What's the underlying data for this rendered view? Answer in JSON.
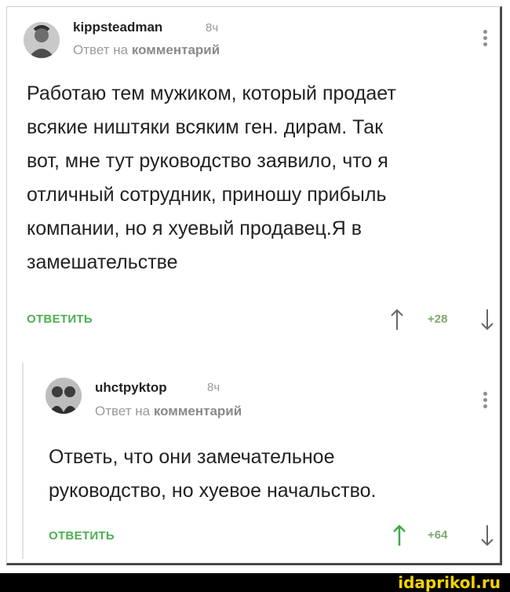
{
  "comment1": {
    "username": "kippsteadman",
    "time": "8ч",
    "reply_prefix": "Ответ на",
    "reply_target": "комментарий",
    "text_lines": [
      "Работаю тем мужиком, который продает",
      "всякие ништяки всяким ген. дирам. Так",
      "вот, мне тут руководство заявило, что я",
      "отличный сотрудник, приношу прибыль",
      "компании, но я хуевый продавец.Я в",
      "замешательстве"
    ],
    "reply_label": "ОТВЕТИТЬ",
    "score": "+28"
  },
  "comment2": {
    "username": "uhctpyktop",
    "time": "8ч",
    "reply_prefix": "Ответ на",
    "reply_target": "комментарий",
    "text_lines": [
      "Ответь, что они замечательное",
      "руководство, но хуевое начальство."
    ],
    "reply_label": "ОТВЕТИТЬ",
    "score": "+64"
  },
  "watermark": "idaprikol.ru",
  "colors": {
    "accent_green": "#4caf50",
    "upvote_green": "#4caf50",
    "muted": "#9a9a9a"
  }
}
